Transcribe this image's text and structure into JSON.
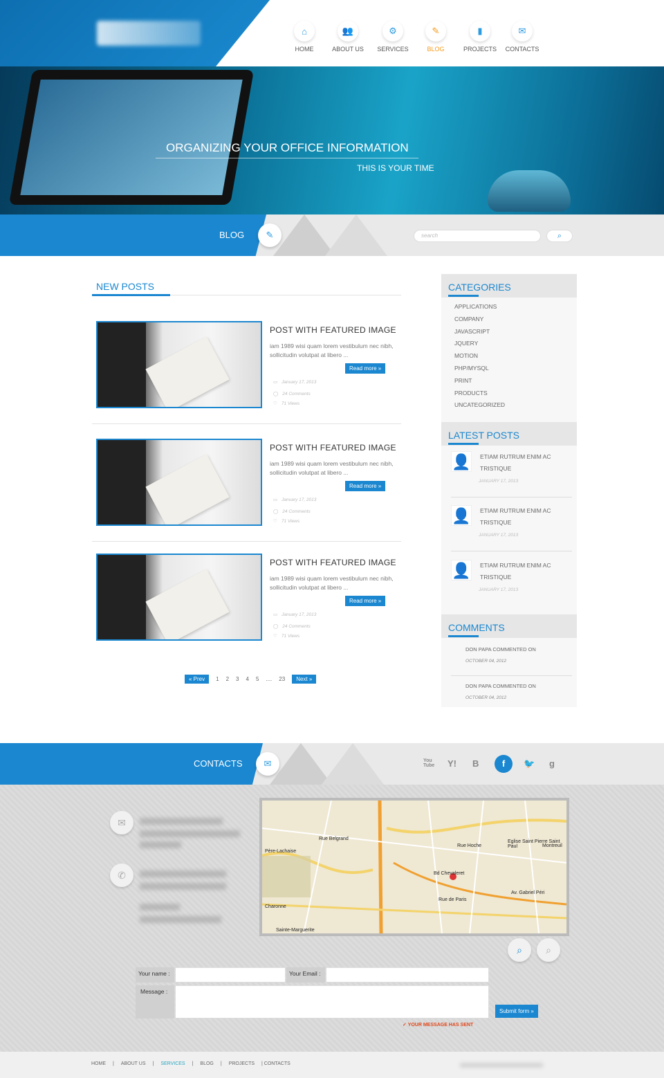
{
  "header": {
    "nav": [
      {
        "label": "HOME",
        "icon": "home-icon",
        "glyph": "⌂"
      },
      {
        "label": "ABOUT US",
        "icon": "users-icon",
        "glyph": "👥"
      },
      {
        "label": "SERVICES",
        "icon": "gears-icon",
        "glyph": "⚙"
      },
      {
        "label": "BLOG",
        "icon": "blog-icon",
        "glyph": "✎",
        "active": true
      },
      {
        "label": "PROJECTS",
        "icon": "bar-chart-icon",
        "glyph": "▮"
      },
      {
        "label": "CONTACTS",
        "icon": "envelope-icon",
        "glyph": "✉"
      }
    ],
    "active_color": "#f59b1c",
    "accent": "#1a87d0"
  },
  "hero": {
    "title": "ORGANIZING YOUR OFFICE INFORMATION",
    "subtitle": "THIS IS YOUR TIME"
  },
  "blogbar": {
    "title": "BLOG",
    "search_placeholder": "search"
  },
  "posts": {
    "heading": "NEW POSTS",
    "items": [
      {
        "title": "POST WITH FEATURED IMAGE",
        "excerpt": "iam 1989 wisi quam lorem vestibulum nec nibh, sollicitudin volutpat at libero ...",
        "read_more": "Read more »",
        "date": "January 17, 2013",
        "comments": "24 Comments",
        "views": "71 Views"
      },
      {
        "title": "POST WITH FEATURED IMAGE",
        "excerpt": "iam 1989 wisi quam lorem vestibulum nec nibh, sollicitudin volutpat at libero ...",
        "read_more": "Read more »",
        "date": "January 17, 2013",
        "comments": "24 Comments",
        "views": "71 Views"
      },
      {
        "title": "POST WITH FEATURED IMAGE",
        "excerpt": "iam 1989 wisi quam lorem vestibulum nec nibh, sollicitudin volutpat at libero ...",
        "read_more": "Read more »",
        "date": "January 17, 2013",
        "comments": "24 Comments",
        "views": "71 Views"
      }
    ],
    "pagination": {
      "prev": "« Prev",
      "pages": [
        "1",
        "2",
        "3",
        "4",
        "5",
        "....",
        "23"
      ],
      "next": "Next »"
    }
  },
  "sidebar": {
    "categories_title": "CATEGORIES",
    "categories": [
      "APPLICATIONS",
      "COMPANY",
      "JAVASCRIPT",
      "JQUERY",
      "MOTION",
      "PHP/MYSQL",
      "PRINT",
      "PRODUCTS",
      "UNCATEGORIZED"
    ],
    "latest_title": "LATEST POSTS",
    "latest": [
      {
        "title": "ETIAM RUTRUM ENIM AC TRISTIQUE",
        "date": "JANUARY 17, 2013"
      },
      {
        "title": "ETIAM RUTRUM ENIM AC TRISTIQUE",
        "date": "JANUARY 17, 2013"
      },
      {
        "title": "ETIAM RUTRUM ENIM AC TRISTIQUE",
        "date": "JANUARY 17, 2013"
      }
    ],
    "comments_title": "COMMENTS",
    "comments": [
      {
        "text": "DON PAPA COMMENTED ON",
        "date": "OCTOBER 04, 2012"
      },
      {
        "text": "DON PAPA COMMENTED ON",
        "date": "OCTOBER 04, 2012"
      }
    ]
  },
  "contacts": {
    "title": "CONTACTS",
    "social": [
      {
        "icon": "youtube-icon",
        "glyph": "You Tube"
      },
      {
        "icon": "yahoo-icon",
        "glyph": "Y!"
      },
      {
        "icon": "blogger-icon",
        "glyph": "B"
      },
      {
        "icon": "facebook-icon",
        "glyph": "f"
      },
      {
        "icon": "twitter-icon",
        "glyph": "🐦"
      },
      {
        "icon": "google-icon",
        "glyph": "g"
      }
    ],
    "map_labels": [
      "Père-Lachaise",
      "Montreuil",
      "Rue Belgrand",
      "Rue Hoche",
      "Charonne",
      "Sainte-Marguerite",
      "Eglise Saint Pierre Saint Paul",
      "Av. Gabriel Péri",
      "Rue de Paris",
      "Bd Chevaleret"
    ],
    "form": {
      "name_label": "Your name :",
      "email_label": "Your Email :",
      "message_label": "Message :",
      "submit": "Submit form »",
      "status": "✓ YOUR MESSAGE HAS SENT",
      "status_color": "#e0471b"
    }
  },
  "footer": {
    "links": [
      "HOME",
      "|",
      "ABOUT US",
      "|",
      "SERVICES",
      "|",
      "BLOG",
      "|",
      "PROJECTS",
      "| CONTACTS"
    ]
  }
}
